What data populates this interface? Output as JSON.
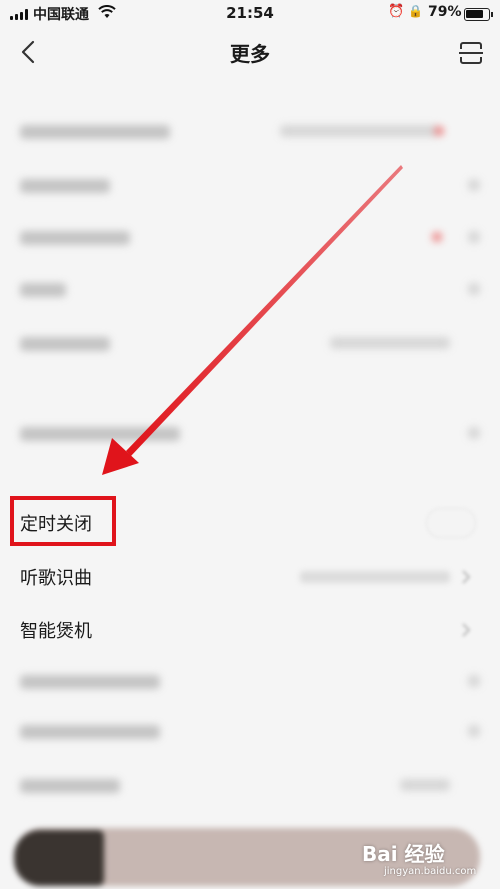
{
  "status_bar": {
    "carrier": "中国联通",
    "time": "21:54",
    "battery": "79%",
    "battery_level": 0.79,
    "icons": [
      "signal-icon",
      "wifi-icon",
      "alarm-icon",
      "orientation-lock-icon",
      "battery-icon"
    ]
  },
  "nav": {
    "title": "更多",
    "back_icon": "chevron-left-icon",
    "scan_icon": "scan-icon"
  },
  "menu": {
    "items": [
      {
        "label": "定时关闭",
        "control": "toggle"
      },
      {
        "label": "听歌识曲",
        "control": "chevron"
      },
      {
        "label": "智能煲机",
        "control": "chevron"
      }
    ]
  },
  "colors": {
    "background": "#f5f5f5",
    "annotation_red": "#e0141b",
    "text": "#1a1a1a"
  },
  "watermark": {
    "main": "Bai 经验",
    "sub": "jingyan.baidu.com"
  }
}
